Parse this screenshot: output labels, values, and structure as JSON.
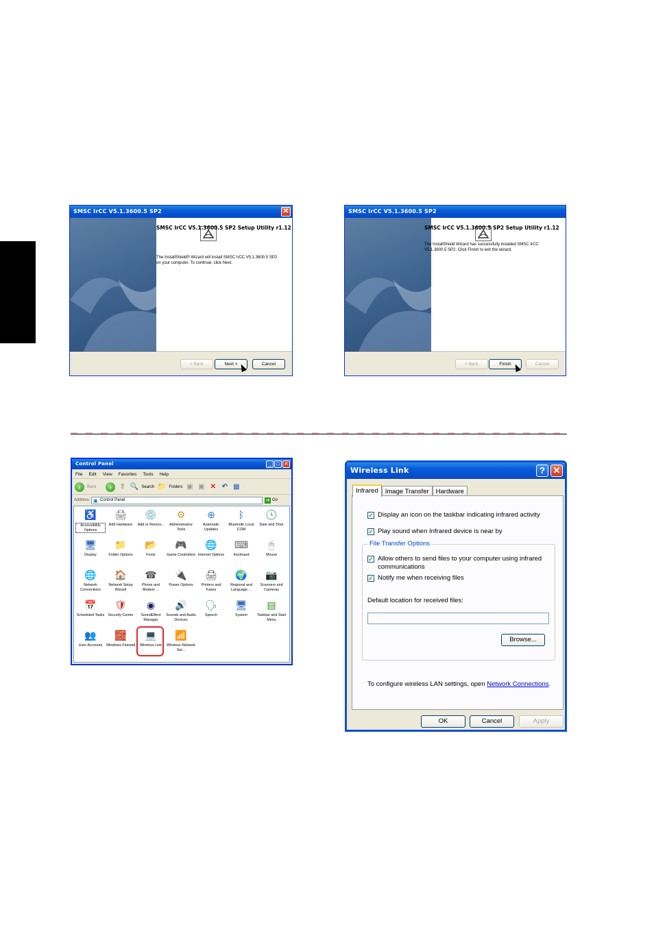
{
  "wizard_install": {
    "title": "SMSC IrCC V5.1.3600.5 SP2",
    "close_glyph": "✕",
    "heading": "SMSC IrCC V5.1.3600.5 SP2 Setup Utility r1.12",
    "body": "The InstallShield® Wizard will install SMSC IrCC V5.1.3600.5 SP2 on your computer.  To continue, click Next.",
    "buttons": {
      "back": "< Back",
      "next": "Next >",
      "cancel": "Cancel"
    }
  },
  "wizard_finish": {
    "title": "SMSC IrCC V5.1.3600.5 SP2",
    "heading": "SMSC IrCC V5.1.3600.5 SP2 Setup Utility r1.12",
    "body": "The InstallShield Wizard has successfully installed SMSC IrCC V5.1.3600.5 SP2.  Click Finish to exit the wizard.",
    "buttons": {
      "back": "< Back",
      "finish": "Finish",
      "cancel": "Cancel"
    }
  },
  "control_panel": {
    "title": "Control Panel",
    "menu": [
      "File",
      "Edit",
      "View",
      "Favorites",
      "Tools",
      "Help"
    ],
    "toolbar": {
      "back": "Back",
      "search": "Search",
      "folders": "Folders"
    },
    "address_label": "Address",
    "address_value": "Control Panel",
    "go_label": "Go",
    "items": [
      {
        "label": "Accessibility Options",
        "icon": "accessibility-icon",
        "glyph": "♿",
        "color": "#3a8f2e"
      },
      {
        "label": "Add Hardware",
        "icon": "add-hardware-icon",
        "glyph": "🖨",
        "color": "#6a6a6a"
      },
      {
        "label": "Add or Remov...",
        "icon": "add-remove-programs-icon",
        "glyph": "💿",
        "color": "#4a7bc8"
      },
      {
        "label": "Administrative Tools",
        "icon": "administrative-tools-icon",
        "glyph": "⚙",
        "color": "#c79a2e"
      },
      {
        "label": "Automatic Updates",
        "icon": "automatic-updates-icon",
        "glyph": "⊕",
        "color": "#2e7bd1"
      },
      {
        "label": "Bluetooth Local COM",
        "icon": "bluetooth-icon",
        "glyph": "ᛒ",
        "color": "#2b5fb8"
      },
      {
        "label": "Date and Time",
        "icon": "date-time-icon",
        "glyph": "🕓",
        "color": "#888888"
      },
      {
        "label": "Display",
        "icon": "display-icon",
        "glyph": "🖥",
        "color": "#3a6fb8"
      },
      {
        "label": "Folder Options",
        "icon": "folder-options-icon",
        "glyph": "📁",
        "color": "#e0b43a"
      },
      {
        "label": "Fonts",
        "icon": "fonts-icon",
        "glyph": "📂",
        "color": "#e0b43a"
      },
      {
        "label": "Game Controllers",
        "icon": "game-controllers-icon",
        "glyph": "🎮",
        "color": "#777777"
      },
      {
        "label": "Internet Options",
        "icon": "internet-options-icon",
        "glyph": "🌐",
        "color": "#2e7bd1"
      },
      {
        "label": "Keyboard",
        "icon": "keyboard-icon",
        "glyph": "⌨",
        "color": "#666666"
      },
      {
        "label": "Mouse",
        "icon": "mouse-icon",
        "glyph": "🖱",
        "color": "#888888"
      },
      {
        "label": "Network Connections",
        "icon": "network-connections-icon",
        "glyph": "🌐",
        "color": "#2e8f5a"
      },
      {
        "label": "Network Setup Wizard",
        "icon": "network-setup-wizard-icon",
        "glyph": "🏠",
        "color": "#c0392b"
      },
      {
        "label": "Phone and Modem ...",
        "icon": "phone-modem-icon",
        "glyph": "☎",
        "color": "#555555"
      },
      {
        "label": "Power Options",
        "icon": "power-options-icon",
        "glyph": "🔌",
        "color": "#d4a02a"
      },
      {
        "label": "Printers and Faxes",
        "icon": "printers-faxes-icon",
        "glyph": "🖨",
        "color": "#555555"
      },
      {
        "label": "Regional and Language ...",
        "icon": "regional-language-icon",
        "glyph": "🌍",
        "color": "#2e7bd1"
      },
      {
        "label": "Scanners and Cameras",
        "icon": "scanners-cameras-icon",
        "glyph": "📷",
        "color": "#666666"
      },
      {
        "label": "Scheduled Tasks",
        "icon": "scheduled-tasks-icon",
        "glyph": "📅",
        "color": "#e0b43a"
      },
      {
        "label": "Security Center",
        "icon": "security-center-icon",
        "glyph": "🛡",
        "color": "#c0392b"
      },
      {
        "label": "SoundEffect Manager",
        "icon": "soundeffect-manager-icon",
        "glyph": "◉",
        "color": "#1c1c6e"
      },
      {
        "label": "Sounds and Audio Devices",
        "icon": "sounds-audio-icon",
        "glyph": "🔊",
        "color": "#777777"
      },
      {
        "label": "Speech",
        "icon": "speech-icon",
        "glyph": "🗣",
        "color": "#2e8f5a"
      },
      {
        "label": "System",
        "icon": "system-icon",
        "glyph": "🖥",
        "color": "#3a6fb8"
      },
      {
        "label": "Taskbar and Start Menu",
        "icon": "taskbar-start-icon",
        "glyph": "▤",
        "color": "#2e8f22"
      },
      {
        "label": "User Accounts",
        "icon": "user-accounts-icon",
        "glyph": "👥",
        "color": "#2e7bd1"
      },
      {
        "label": "Windows Firewall",
        "icon": "windows-firewall-icon",
        "glyph": "🧱",
        "color": "#c0392b"
      },
      {
        "label": "Wireless Link",
        "icon": "wireless-link-icon",
        "glyph": "💻",
        "color": "#3a6fb8"
      },
      {
        "label": "Wireless Network Set...",
        "icon": "wireless-network-setup-icon",
        "glyph": "📶",
        "color": "#2e8f5a"
      }
    ]
  },
  "wireless_link": {
    "title": "Wireless Link",
    "help_glyph": "?",
    "close_glyph": "✕",
    "tabs": [
      "Infrared",
      "Image Transfer",
      "Hardware"
    ],
    "options": {
      "show_icon": {
        "label": "Display an icon on the taskbar indicating infrared activity",
        "checked": true
      },
      "play_sound": {
        "label": "Play sound when Infrared device is near by",
        "checked": true
      }
    },
    "group_label": "File Transfer Options",
    "group_options": {
      "allow_send": {
        "label": "Allow others to send files to your computer using infrared communications",
        "checked": true
      },
      "notify": {
        "label": "Notify me when receiving files",
        "checked": true
      }
    },
    "default_location_label": "Default location for received files:",
    "default_location_value": "",
    "browse_label": "Browse...",
    "footer_text": "To configure wireless LAN settings, open ",
    "footer_link": "Network Connections",
    "footer_end": ".",
    "buttons": {
      "ok": "OK",
      "cancel": "Cancel",
      "apply": "Apply"
    }
  }
}
